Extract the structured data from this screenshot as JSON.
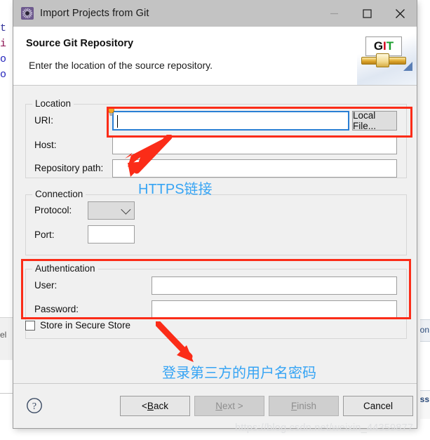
{
  "window": {
    "title": "Import Projects from Git",
    "icon": "git-import-wizard-icon",
    "minimize_label": "—",
    "maximize_label": "□",
    "close_label": "×"
  },
  "header": {
    "title": "Source Git Repository",
    "subtitle": "Enter the location of the source repository.",
    "logo_text": {
      "g": "G",
      "i": "I",
      "t": "T"
    }
  },
  "location": {
    "group_title": "Location",
    "uri_label": "URI:",
    "uri_value": "",
    "uri_placeholder": "",
    "local_file_button": "Local File...",
    "host_label": "Host:",
    "host_value": "",
    "repo_path_label": "Repository path:",
    "repo_path_value": ""
  },
  "connection": {
    "group_title": "Connection",
    "protocol_label": "Protocol:",
    "protocol_value": "",
    "port_label": "Port:",
    "port_value": ""
  },
  "authentication": {
    "group_title": "Authentication",
    "user_label": "User:",
    "user_value": "",
    "password_label": "Password:",
    "password_value": "",
    "store_checkbox_label": "Store in Secure Store",
    "store_checkbox_checked": false
  },
  "footer": {
    "help_label": "?",
    "back_label": "< Back",
    "next_label": "Next >",
    "finish_label": "Finish",
    "cancel_label": "Cancel",
    "back_enabled": true,
    "next_enabled": false,
    "finish_enabled": false,
    "cancel_enabled": true
  },
  "annotations": {
    "highlight_color": "#fb2c18",
    "note_color": "#36a4f4",
    "note_uri": "HTTPS链接",
    "note_auth": "登录第三方的用户名密码"
  },
  "watermark": {
    "text": "https://blog.csdn.net/weixin_44359877"
  },
  "background": {
    "code_lines": [
      "t",
      "i",
      "o",
      "o"
    ],
    "right_text_1": "on",
    "right_text_2": "ss"
  }
}
